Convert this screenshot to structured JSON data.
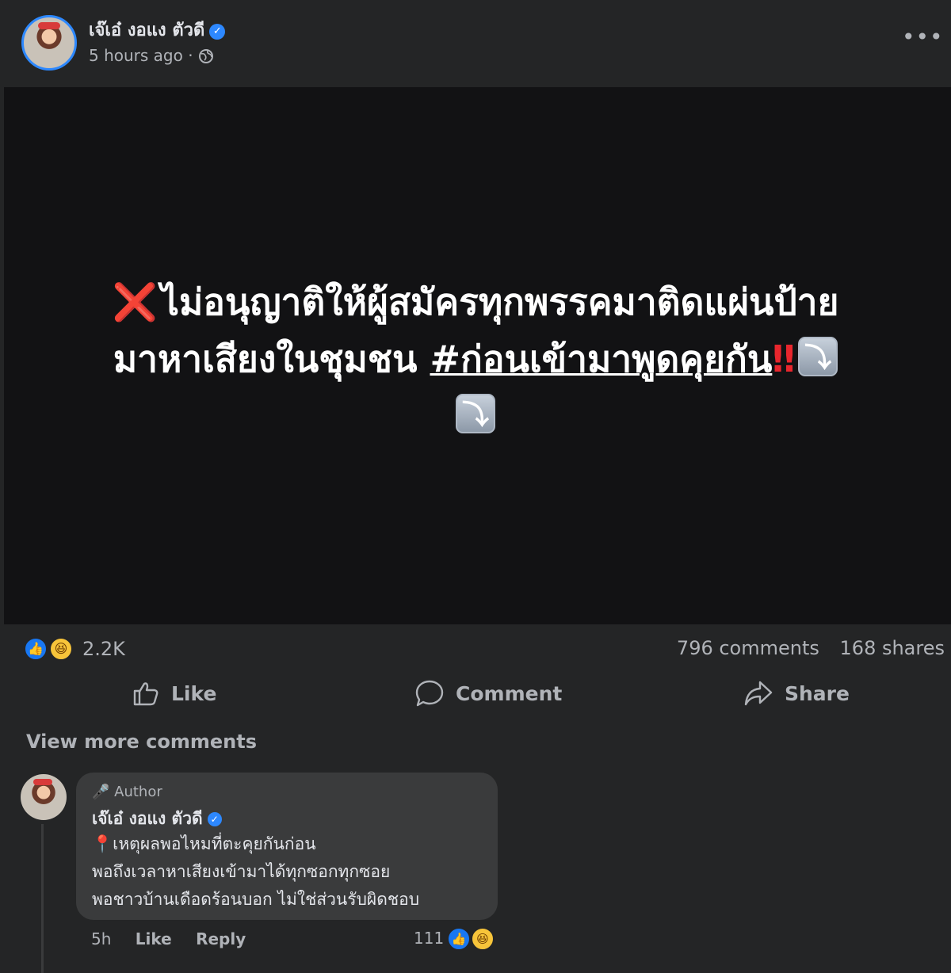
{
  "post": {
    "author": "เจ๊เอ๋ งอแง ตัวดี",
    "time": "5 hours ago",
    "separator": "·",
    "icons": {
      "verified": "verified-badge-icon",
      "privacy": "globe-icon",
      "more": "more-options-icon"
    }
  },
  "media": {
    "line1": "ไม่อนุญาติให้ผู้สมัครทุกพรรคมาติดแผ่นป้าย",
    "line2_plain": "มาหาเสียงในชุมชน",
    "line2_hashtag": "#ก่อนเข้ามาพูดคุยกัน",
    "emoji": {
      "cross": "❌",
      "double_exclamation": "‼",
      "arrow": "⤵"
    },
    "colors": {
      "background": "#121214",
      "text": "#ffffff",
      "accent_red": "#e8262d"
    }
  },
  "stats": {
    "reaction_count": "2.2K",
    "comments": "796 comments",
    "shares": "168 shares",
    "reaction_icons": [
      "like-reaction-icon",
      "haha-reaction-icon"
    ]
  },
  "actions": {
    "like": "Like",
    "comment": "Comment",
    "share": "Share"
  },
  "comments": {
    "view_more": "View more comments",
    "items": [
      {
        "badge": "Author",
        "author": "เจ๊เอ๋ งอแง ตัวดี",
        "lines": [
          "เหตุผลพอไหมที่ตะคุยกันก่อน",
          "พอถึงเวลาหาเสียงเข้ามาได้ทุกซอกทุกซอย",
          "พอชาวบ้านเดือดร้อนบอก ไม่ใช่ส่วนรับผิดชอบ"
        ],
        "time": "5h",
        "like": "Like",
        "reply": "Reply",
        "reaction_count": "111"
      }
    ]
  },
  "theme": {
    "background": "#242526",
    "bubble": "#3a3b3c",
    "primary_text": "#e4e6eb",
    "secondary_text": "#b0b3b8",
    "brand_blue": "#1877f2"
  }
}
